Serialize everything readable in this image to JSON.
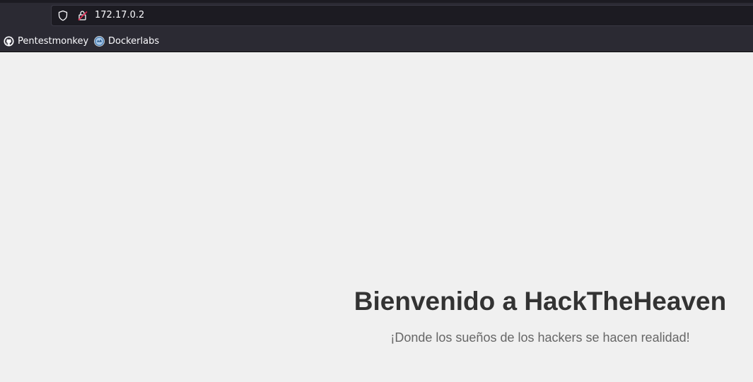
{
  "browser": {
    "url": "172.17.0.2",
    "bookmarks": [
      {
        "label": "Pentestmonkey",
        "icon": "github-icon"
      },
      {
        "label": "Dockerlabs",
        "icon": "dockerlabs-icon"
      }
    ]
  },
  "page": {
    "title": "Bienvenido a HackTheHeaven",
    "subtitle": "¡Donde los sueños de los hackers se hacen realidad!"
  },
  "colors": {
    "chrome_bg": "#2b2a33",
    "urlbar_bg": "#1c1b22",
    "page_bg": "#f0f0f0",
    "title_color": "#333333",
    "subtitle_color": "#666666"
  }
}
